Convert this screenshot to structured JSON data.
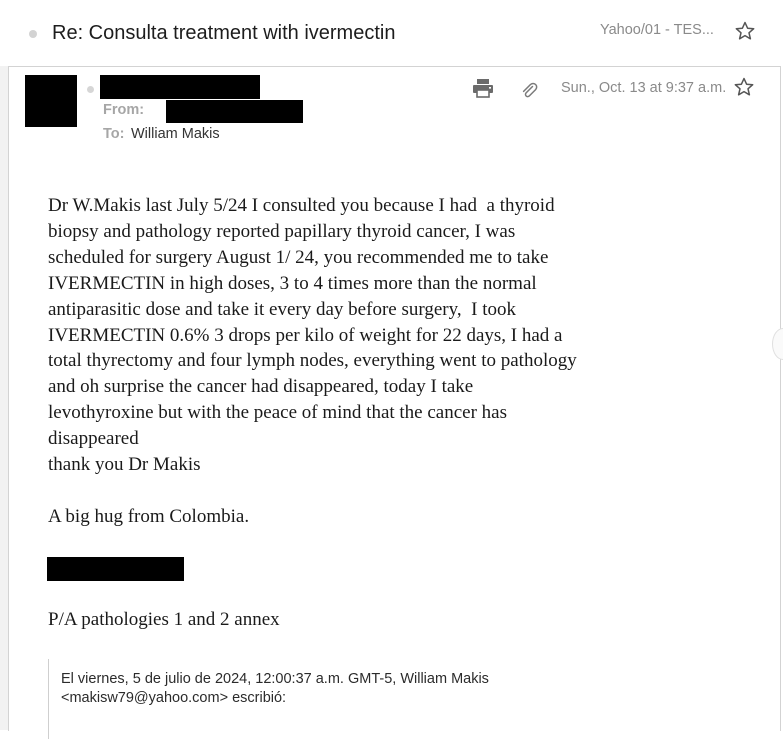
{
  "thread": {
    "subject": "Re: Consulta treatment with ivermectin",
    "folder": "Yahoo/01 - TES..."
  },
  "message": {
    "from_label": "From:",
    "to_label": "To:",
    "to_name": "William Makis",
    "date": "Sun., Oct. 13 at 9:37 a.m.",
    "body": {
      "paragraph1_lines": [
        "Dr W.Makis last July 5/24 I consulted you because I had  a thyroid",
        "biopsy and pathology reported papillary thyroid cancer, I was",
        "scheduled for surgery August 1/ 24, you recommended me to take",
        "IVERMECTIN in high doses, 3 to 4 times more than the normal",
        "antiparasitic dose and take it every day before surgery,  I took",
        "IVERMECTIN 0.6% 3 drops per kilo of weight for 22 days, I had a",
        "total thyrectomy and four lymph nodes, everything went to pathology",
        "and oh surprise the cancer had disappeared, today I take",
        "levothyroxine but with the peace of mind that the cancer has",
        "disappeared",
        "thank you Dr Makis"
      ],
      "greeting": "A big hug from Colombia.",
      "postscript": "P/A pathologies 1 and 2 annex"
    },
    "quote": {
      "line1": "El viernes, 5 de julio de 2024, 12:00:37 a.m. GMT-5, William Makis",
      "line2": "<makisw79@yahoo.com> escribió:"
    }
  },
  "icons": {
    "star": "star-outline-icon",
    "print": "printer-icon",
    "attach": "paperclip-icon"
  },
  "colors": {
    "redaction": "#000000",
    "muted_text": "#8a8a8a",
    "label_grey": "#a6a6a6"
  }
}
